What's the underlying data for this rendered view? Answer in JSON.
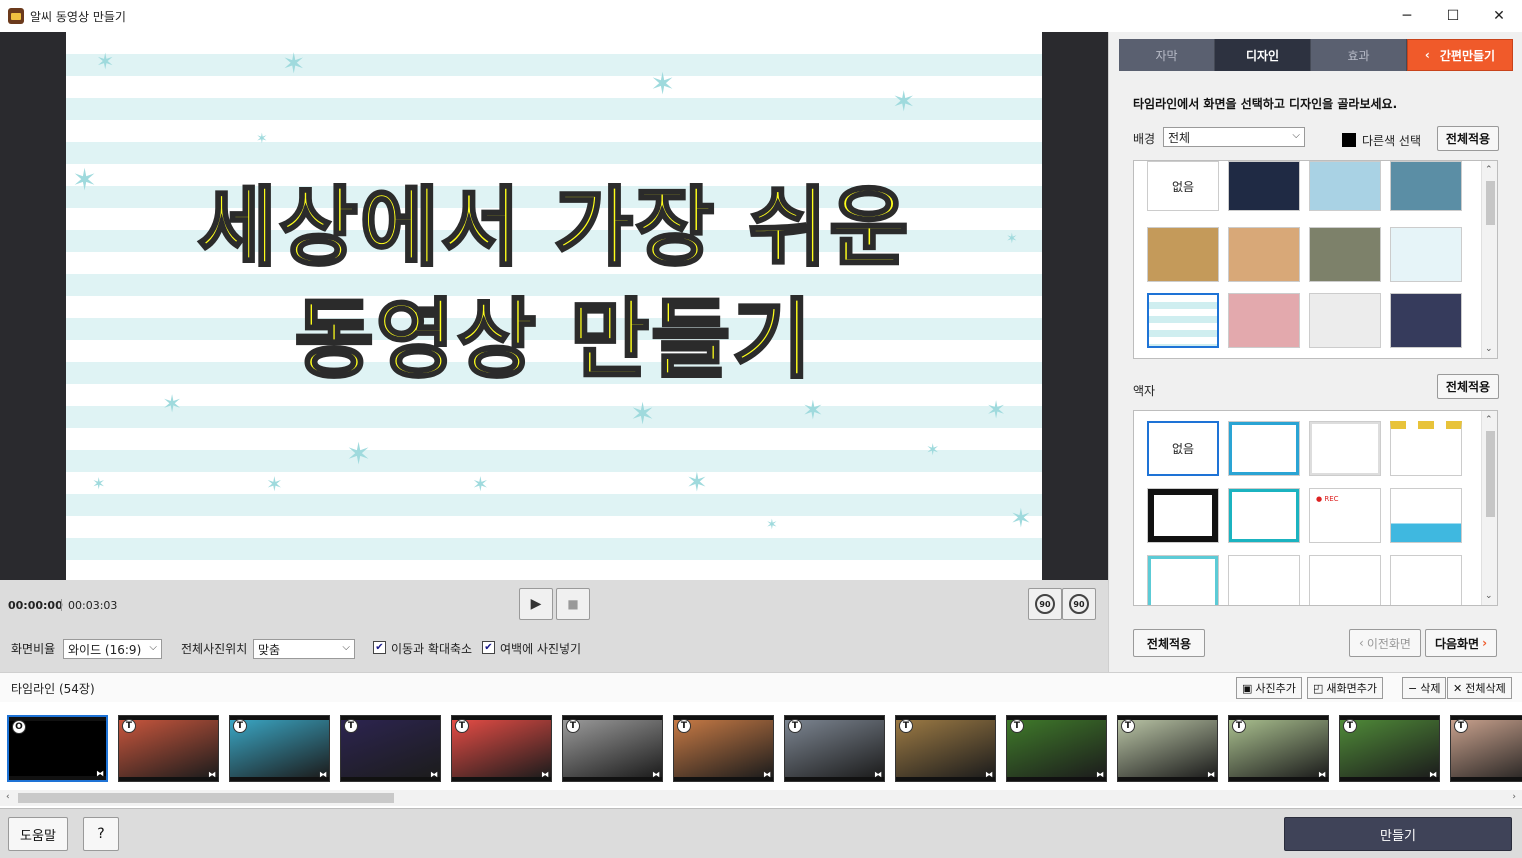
{
  "window": {
    "title": "알씨 동영상 만들기",
    "minimize": "─",
    "maximize": "☐",
    "close": "✕"
  },
  "preview": {
    "line1": "세상에서 가장 쉬운",
    "line2": "동영상 만들기"
  },
  "playback": {
    "current_time": "00:00:00",
    "total_time": "00:03:03",
    "play_icon": "▶",
    "stop_icon": "■",
    "rotate_left": "90",
    "rotate_right": "90"
  },
  "options": {
    "ratio_label": "화면비율",
    "ratio_value": "와이드 (16:9)",
    "position_label": "전체사진위치",
    "position_value": "맞춤",
    "move_zoom_label": "이동과 확대축소",
    "move_zoom_checked": true,
    "margin_label": "여백에 사진넣기",
    "margin_checked": true
  },
  "right_panel": {
    "tabs": [
      "자막",
      "디자인",
      "효과"
    ],
    "active_tab": 1,
    "easy_label": "간편만들기",
    "instruction": "타임라인에서 화면을 선택하고 디자인을 골라보세요.",
    "bg_label": "배경",
    "bg_select": "전체",
    "other_color_label": "다른색 선택",
    "apply_all": "전체적용",
    "bg_tiles": [
      {
        "label": "없음",
        "color": "#ffffff"
      },
      {
        "label": "",
        "color": "#1f2a44"
      },
      {
        "label": "",
        "color": "#a9d2e4"
      },
      {
        "label": "",
        "color": "#5b8ea5"
      },
      {
        "label": "",
        "color": "#c49a5a"
      },
      {
        "label": "",
        "color": "#d8a878"
      },
      {
        "label": "",
        "color": "#7d816a"
      },
      {
        "label": "",
        "color": "#e6f4f8"
      },
      {
        "label": "",
        "color": "#e5f5f6"
      },
      {
        "label": "",
        "color": "#e3a9ad"
      },
      {
        "label": "",
        "color": "#ececec"
      },
      {
        "label": "",
        "color": "#363b5c"
      }
    ],
    "frame_label": "액자",
    "frame_tiles": [
      {
        "label": "없음"
      },
      {
        "label": ""
      },
      {
        "label": ""
      },
      {
        "label": ""
      },
      {
        "label": ""
      },
      {
        "label": ""
      },
      {
        "label": "● REC"
      },
      {
        "label": ""
      },
      {
        "label": ""
      },
      {
        "label": ""
      },
      {
        "label": ""
      },
      {
        "label": ""
      }
    ],
    "apply_all_bottom": "전체적용",
    "prev_screen": "이전화면",
    "next_screen": "다음화면"
  },
  "timeline": {
    "title": "타임라인 (54장)",
    "add_photo": "사진추가",
    "add_new_screen": "새화면추가",
    "delete": "삭제",
    "delete_all": "전체삭제",
    "items": [
      {
        "badge": "O",
        "color": "#000000"
      },
      {
        "badge": "T",
        "color": "#c8563d"
      },
      {
        "badge": "T",
        "color": "#3aa6c4"
      },
      {
        "badge": "T",
        "color": "#2c2450"
      },
      {
        "badge": "T",
        "color": "#e54c45"
      },
      {
        "badge": "T",
        "color": "#9a9a9a"
      },
      {
        "badge": "T",
        "color": "#c77a45"
      },
      {
        "badge": "T",
        "color": "#7c8591"
      },
      {
        "badge": "T",
        "color": "#9c7a44"
      },
      {
        "badge": "T",
        "color": "#3f7a2a"
      },
      {
        "badge": "T",
        "color": "#b9c4a5"
      },
      {
        "badge": "T",
        "color": "#a9bf8e"
      },
      {
        "badge": "T",
        "color": "#4f8a38"
      },
      {
        "badge": "T",
        "color": "#c7a08c"
      }
    ]
  },
  "footer": {
    "help": "도움말",
    "question": "?",
    "make": "만들기"
  }
}
